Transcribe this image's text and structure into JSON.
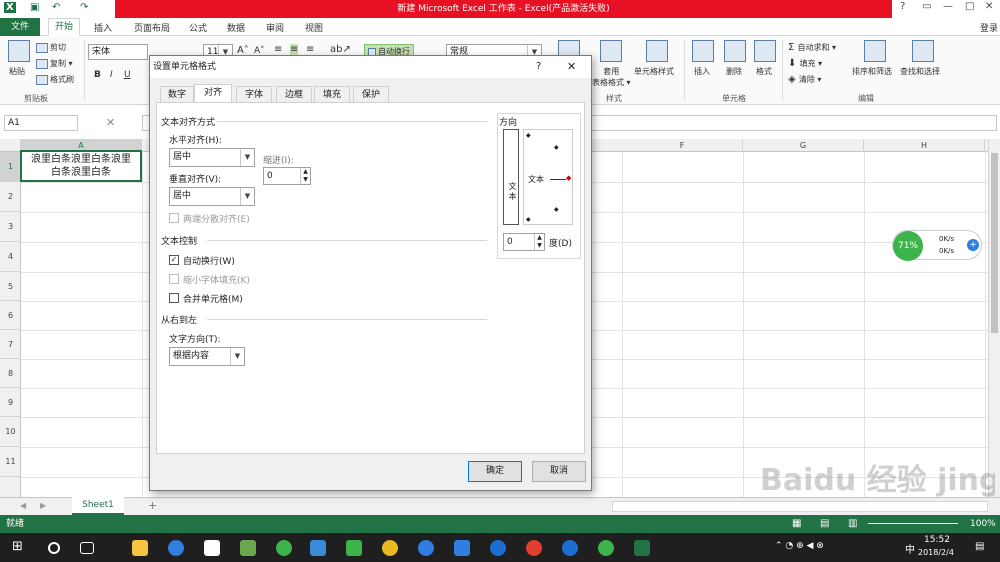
{
  "window": {
    "title": "新建 Microsoft Excel 工作表 - Excel(产品激活失败)",
    "help": "?",
    "minimize": "—",
    "restore": "□",
    "close": "✕",
    "login": "登录"
  },
  "tabs": [
    "文件",
    "开始",
    "插入",
    "页面布局",
    "公式",
    "数据",
    "审阅",
    "视图"
  ],
  "ribbon": {
    "paste": "粘贴",
    "cut": "剪切",
    "copy": "复制 ▾",
    "format_painter": "格式刷",
    "clipboard": "剪贴板",
    "font_name": "宋体",
    "font_size": "11",
    "bold": "B",
    "italic": "I",
    "underline": "U",
    "wrap_text": "自动换行",
    "number_format": "常规",
    "cond_format": "条件格式",
    "table_format": "套用\n表格格式 ▾",
    "cell_styles": "单元格样式",
    "styles": "样式",
    "insert": "插入",
    "delete": "删除",
    "format": "格式",
    "cells": "单元格",
    "autosum": "自动求和 ▾",
    "fill": "填充 ▾",
    "clear": "清除 ▾",
    "sort_filter": "排序和筛选",
    "find_select": "查找和选择",
    "editing": "编辑"
  },
  "formula_bar": {
    "name_box": "A1",
    "cancel": "✕",
    "enter": "✓",
    "fx": "fx"
  },
  "sheet": {
    "columns": [
      "A",
      "F",
      "G",
      "H"
    ],
    "rows": [
      "1",
      "2",
      "3",
      "4",
      "5",
      "6",
      "7",
      "8",
      "9",
      "10",
      "11"
    ],
    "cell_a1_line1": "浪里白条浪里白条浪里",
    "cell_a1_line2": "白条浪里白条"
  },
  "sheet_tabs": {
    "name": "Sheet1",
    "add": "+"
  },
  "status": {
    "ready": "就绪",
    "zoom": "100%"
  },
  "dialog": {
    "title": "设置单元格格式",
    "help": "?",
    "close": "✕",
    "tabs": [
      "数字",
      "对齐",
      "字体",
      "边框",
      "填充",
      "保护"
    ],
    "active_tab": "对齐",
    "text_align_section": "文本对齐方式",
    "horizontal_label": "水平对齐(H):",
    "horizontal_value": "居中",
    "indent_label": "缩进(I):",
    "indent_value": "0",
    "vertical_label": "垂直对齐(V):",
    "vertical_value": "居中",
    "distributed": "两端分散对齐(E)",
    "text_control_section": "文本控制",
    "wrap_text": "自动换行(W)",
    "wrap_text_checked": true,
    "shrink": "缩小字体填充(K)",
    "merge": "合并单元格(M)",
    "rtl_section": "从右到左",
    "text_dir_label": "文字方向(T):",
    "text_dir_value": "根据内容",
    "orientation_section": "方向",
    "vertical_text": "文本",
    "orient_text": "文本",
    "degree_value": "0",
    "degree_label": "度(D)",
    "ok": "确定",
    "cancel": "取消"
  },
  "widget": {
    "percent": "71%",
    "up": "0K/s",
    "down": "0K/s"
  },
  "taskbar": {
    "time": "15:52",
    "date": "2018/2/4",
    "lang": "中"
  },
  "watermark": "Baidu 经验  jingyan.baidu.com"
}
